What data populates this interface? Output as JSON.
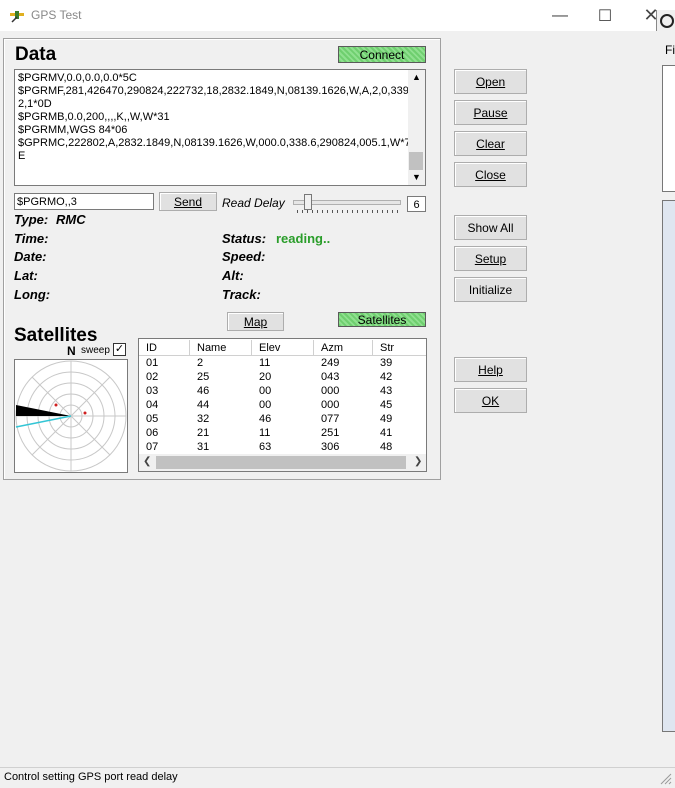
{
  "window": {
    "title": "GPS Test"
  },
  "data_section": {
    "heading": "Data",
    "connect_label": "Connect",
    "nmea_lines": [
      "$PGRMV,0.0,0.0,0.0*5C",
      "$PGRMF,281,426470,290824,222732,18,2832.1849,N,08139.1626,W,A,2,0,339,",
      "2,1*0D",
      "$PGRMB,0.0,200,,,,K,,W,W*31",
      "$PGRMM,WGS 84*06",
      "$GPRMC,222802,A,2832.1849,N,08139.1626,W,000.0,338.6,290824,005.1,W*7",
      "E"
    ],
    "command_value": "$PGRMO,,3",
    "send_label": "Send",
    "read_delay_label": "Read Delay",
    "read_delay_value": "6",
    "read_delay_fraction": 0.1
  },
  "fields": {
    "type_label": "Type:",
    "type_value": "RMC",
    "time_label": "Time:",
    "date_label": "Date:",
    "lat_label": "Lat:",
    "long_label": "Long:",
    "status_label": "Status:",
    "status_value": "reading..",
    "speed_label": "Speed:",
    "alt_label": "Alt:",
    "track_label": "Track:"
  },
  "map_label": "Map",
  "satellites_button_label": "Satellites",
  "satellites": {
    "heading": "Satellites",
    "north_label": "N",
    "sweep_label": "sweep",
    "sweep_checked": true,
    "columns": [
      "ID",
      "Name",
      "Elev",
      "Azm",
      "Str"
    ],
    "rows": [
      [
        "01",
        "2",
        "11",
        "249",
        "39"
      ],
      [
        "02",
        "25",
        "20",
        "043",
        "42"
      ],
      [
        "03",
        "46",
        "00",
        "000",
        "43"
      ],
      [
        "04",
        "44",
        "00",
        "000",
        "45"
      ],
      [
        "05",
        "32",
        "46",
        "077",
        "49"
      ],
      [
        "06",
        "21",
        "11",
        "251",
        "41"
      ],
      [
        "07",
        "31",
        "63",
        "306",
        "48"
      ]
    ]
  },
  "right_buttons": {
    "open": "Open",
    "pause": "Pause",
    "clear": "Clear",
    "close": "Close",
    "show_all": "Show All",
    "setup": "Setup",
    "initialize": "Initialize",
    "help": "Help",
    "ok": "OK"
  },
  "statusbar": {
    "text": "Control setting GPS port read delay"
  },
  "background_window": {
    "menu_fragment": "Fil"
  },
  "colors": {
    "connect_green": "#7cd97c",
    "status_green": "#2a9d2a"
  },
  "icons": {
    "app": "satellite-icon",
    "minimize": "minimize-icon",
    "maximize": "maximize-icon",
    "close": "close-icon"
  }
}
